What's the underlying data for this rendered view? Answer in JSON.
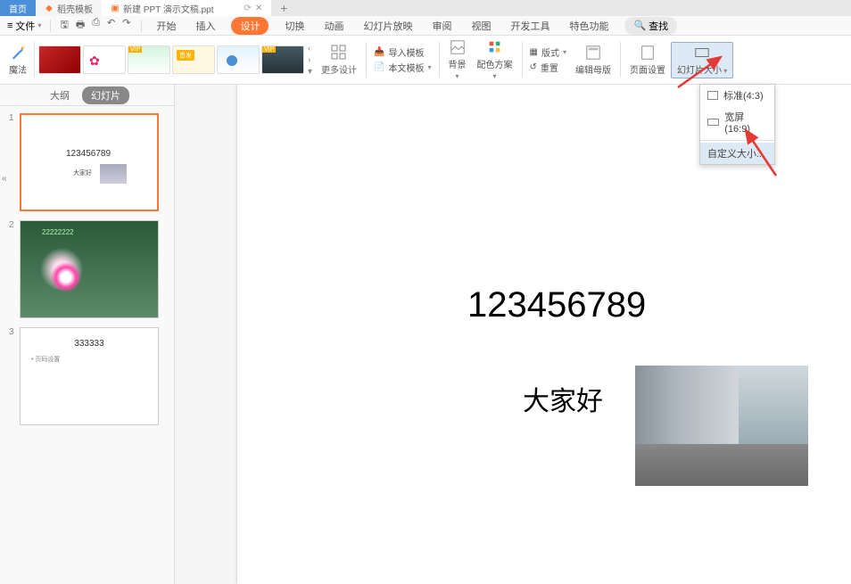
{
  "tabs": {
    "home": "首页",
    "template": "稻壳模板",
    "doc": "新建 PPT 演示文稿.ppt"
  },
  "menu": {
    "file": "文件",
    "items": [
      "开始",
      "插入",
      "设计",
      "切换",
      "动画",
      "幻灯片放映",
      "审阅",
      "视图",
      "开发工具",
      "特色功能"
    ],
    "search": "查找"
  },
  "ribbon": {
    "magic": "魔法",
    "more_design": "更多设计",
    "import_template": "导入模板",
    "local_template": "本文模板",
    "background": "背景",
    "color_scheme": "配色方案",
    "reset": "重置",
    "layout": "版式",
    "edit_master": "编辑母版",
    "page_setup": "页面设置",
    "slide_size": "幻灯片大小"
  },
  "dropdown": {
    "standard": "标准(4:3)",
    "widescreen": "宽屏(16:9)",
    "custom": "自定义大小..."
  },
  "outline": {
    "tab_outline": "大纲",
    "tab_slides": "幻灯片"
  },
  "slides": [
    {
      "title": "123456789",
      "subtitle": "大家好"
    },
    {
      "overlay": "22222222"
    },
    {
      "title": "333333",
      "bullet": "页码设置"
    }
  ],
  "canvas": {
    "title": "123456789",
    "subtitle": "大家好"
  }
}
